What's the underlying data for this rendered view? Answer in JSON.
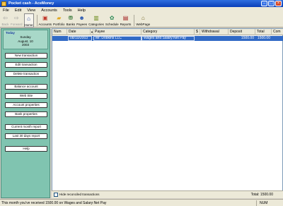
{
  "window": {
    "title": "Pocket cash - AceMoney"
  },
  "menu": [
    "File",
    "Edit",
    "View",
    "Accounts",
    "Tools",
    "Help"
  ],
  "toolbar": [
    {
      "label": "Back",
      "icon": "back-arrow-icon",
      "glyph": "⇦",
      "color": "#9a9a9a",
      "disabled": true
    },
    {
      "label": "Forward",
      "icon": "forward-arrow-icon",
      "glyph": "⇨",
      "color": "#9a9a9a",
      "disabled": true
    },
    {
      "label": "Home",
      "icon": "home-icon",
      "glyph": "⌂",
      "color": "#2a4fa8",
      "active": true
    },
    {
      "label": "Accounts",
      "icon": "accounts-icon",
      "glyph": "▣",
      "color": "#c0392b"
    },
    {
      "label": "Portfolio",
      "icon": "portfolio-icon",
      "glyph": "▰",
      "color": "#e0a820"
    },
    {
      "label": "Banks",
      "icon": "banks-icon",
      "glyph": "⛃",
      "color": "#3a7a3a"
    },
    {
      "label": "Payees",
      "icon": "payees-icon",
      "glyph": "☻",
      "color": "#2a58b0"
    },
    {
      "label": "Categories",
      "icon": "categories-icon",
      "glyph": "▥",
      "color": "#6a8a1a"
    },
    {
      "label": "Schedule",
      "icon": "schedule-icon",
      "glyph": "✿",
      "color": "#2e8b57"
    },
    {
      "label": "Reports",
      "icon": "reports-icon",
      "glyph": "▤",
      "color": "#a01818"
    },
    {
      "label": "WebPage",
      "icon": "webpage-icon",
      "glyph": "⌂",
      "color": "#7a6a2a"
    }
  ],
  "today": {
    "header": "Today",
    "weekday": "Sunday",
    "date_line": "August, 10",
    "year": "2003"
  },
  "nav_buttons": [
    "New transaction",
    "Edit transaction",
    "Delete transaction",
    "Balance account",
    "Web Site",
    "Account properties",
    "Bank properties",
    "Current month report",
    "Last 30 days report",
    "Help"
  ],
  "table": {
    "columns": [
      "Num",
      "Date",
      "Payee",
      "Category",
      "$",
      "Withdrawal",
      "Deposit",
      "Total",
      "Com"
    ],
    "rows": [
      {
        "num": "",
        "date": "08/10/2003",
        "payee": "Mr. Dobkins LLC",
        "category": "Wages and Salary:Net Pay",
        "cleared": "",
        "withdrawal": "",
        "deposit": "1500.00",
        "total": "1500.00"
      }
    ]
  },
  "footer": {
    "checkbox_label": "Hide reconciled transactions",
    "total": "Total: 1500.00"
  },
  "status": {
    "message": "This month you've received 1500.00 on Wages and Salary:Net Pay",
    "num": "NUM"
  },
  "colors": {
    "accent": "#316ac5",
    "panel": "#80c4b0",
    "title_bar": "#0a3fb8"
  }
}
